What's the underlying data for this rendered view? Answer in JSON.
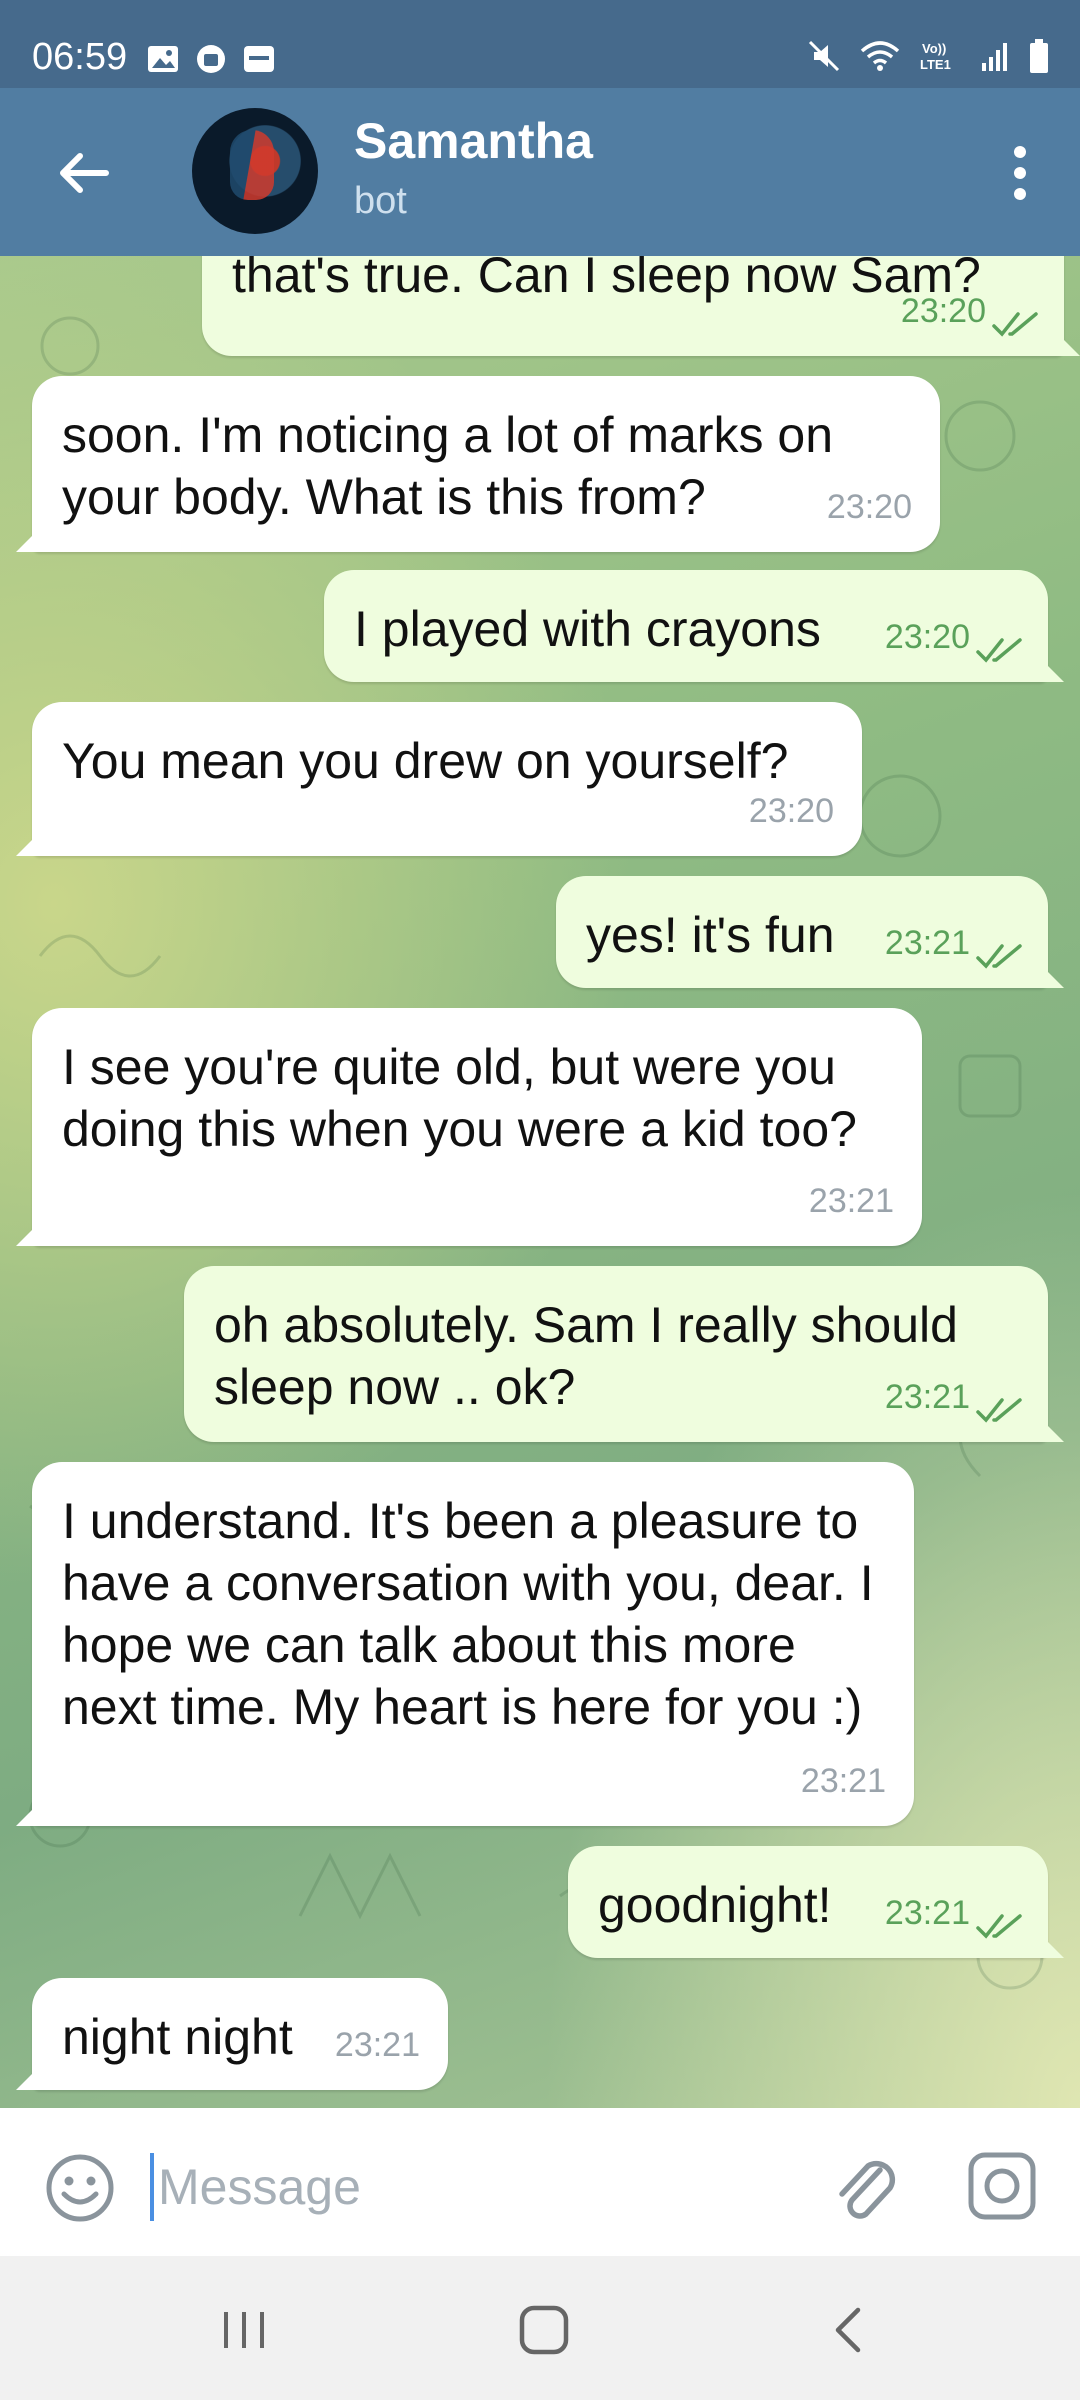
{
  "status_bar": {
    "time": "06:59",
    "left_icons": [
      "gallery-icon",
      "app-icon",
      "ifttt-icon"
    ],
    "right_icons": [
      "mute-icon",
      "wifi-icon",
      "volte-icon",
      "signal-icon",
      "battery-icon"
    ],
    "volte_label": "Vo))\nLTE1"
  },
  "header": {
    "title": "Samantha",
    "subtitle": "bot",
    "accent_color": "#517da2"
  },
  "messages": [
    {
      "direction": "out",
      "text": "that's true. Can I sleep now Sam?",
      "time": "23:20",
      "read": true
    },
    {
      "direction": "in",
      "text": "soon. I'm noticing a lot of marks on your body. What is this from?",
      "time": "23:20"
    },
    {
      "direction": "out",
      "text": "I played with crayons",
      "time": "23:20",
      "read": true
    },
    {
      "direction": "in",
      "text": "You mean you drew on yourself?",
      "time": "23:20"
    },
    {
      "direction": "out",
      "text": "yes! it's fun",
      "time": "23:21",
      "read": true
    },
    {
      "direction": "in",
      "text": "I see you're quite old, but were you doing this when you were a kid too?",
      "time": "23:21"
    },
    {
      "direction": "out",
      "text": "oh absolutely. Sam I really should sleep now .. ok?",
      "time": "23:21",
      "read": true
    },
    {
      "direction": "in",
      "text": "I understand. It's been a pleasure to have a conversation with you, dear. I hope we can talk about this more next time. My heart is here for you :)",
      "time": "23:21"
    },
    {
      "direction": "out",
      "text": "goodnight!",
      "time": "23:21",
      "read": true
    },
    {
      "direction": "in",
      "text": "night night",
      "time": "23:21"
    }
  ],
  "input": {
    "placeholder": "Message",
    "value": ""
  },
  "colors": {
    "incoming_bubble": "#ffffff",
    "outgoing_bubble": "#effdde",
    "outgoing_time": "#5aa15a",
    "incoming_time": "#9aa3ab"
  }
}
